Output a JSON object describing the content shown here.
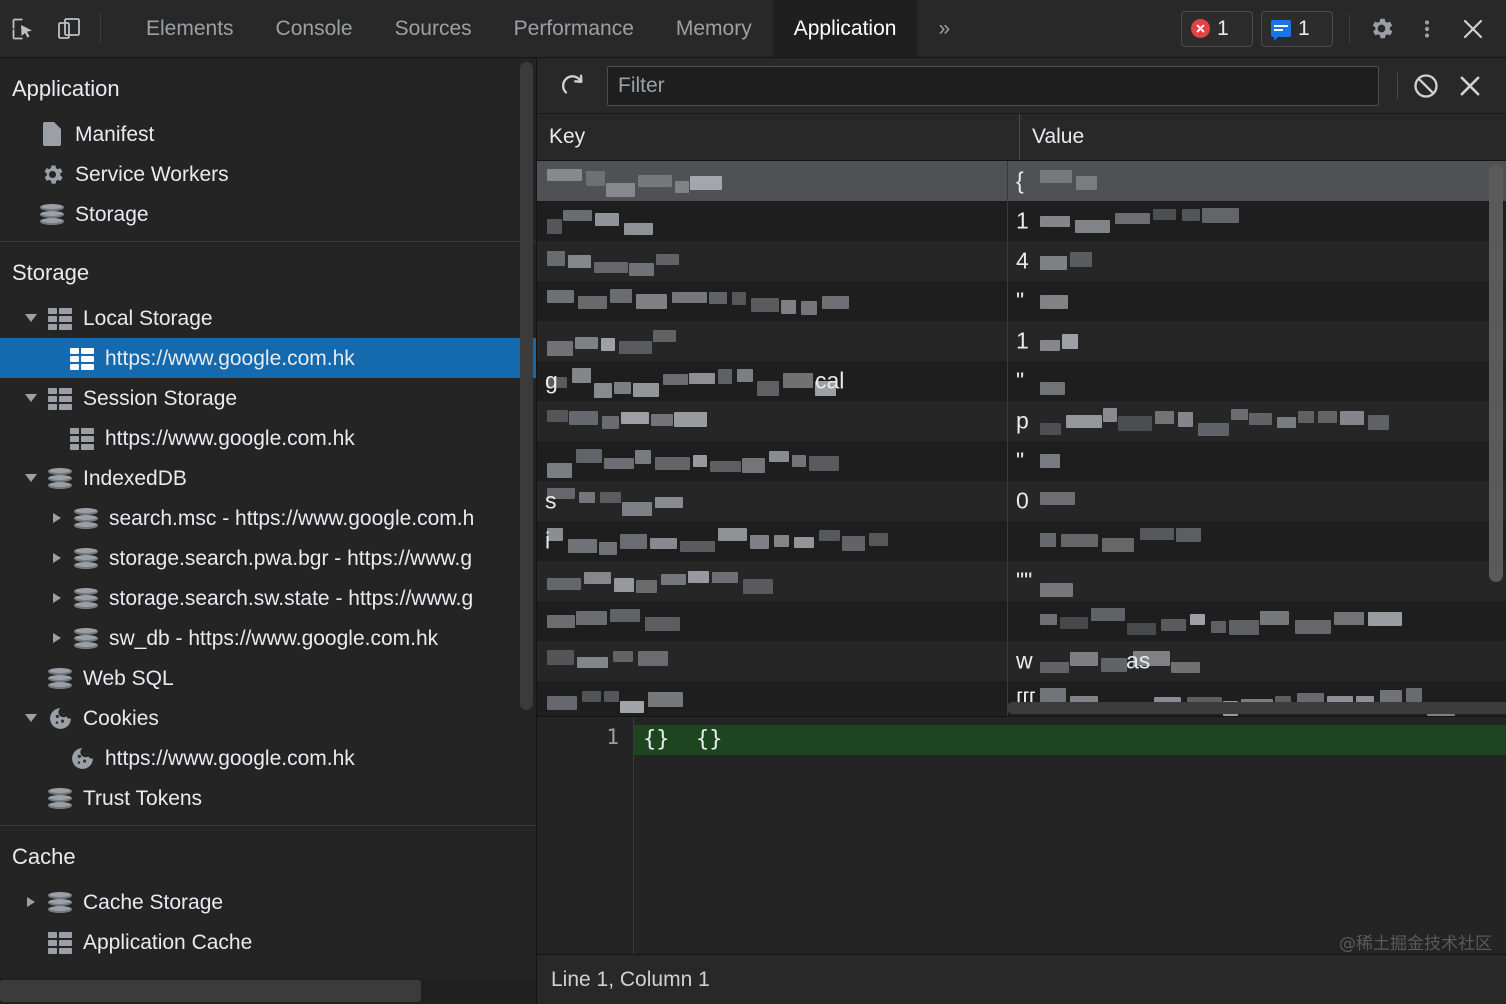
{
  "toolbar": {
    "inspect_icon": "inspect-element-icon",
    "device_icon": "toggle-device-toolbar-icon",
    "tabs": [
      {
        "label": "Elements",
        "active": false
      },
      {
        "label": "Console",
        "active": false
      },
      {
        "label": "Sources",
        "active": false
      },
      {
        "label": "Performance",
        "active": false
      },
      {
        "label": "Memory",
        "active": false
      },
      {
        "label": "Application",
        "active": true
      }
    ],
    "more_tabs_label": "»",
    "error_count": "1",
    "message_count": "1",
    "settings_icon": "gear-icon",
    "more_options_icon": "kebab-menu-icon",
    "close_icon": "close-icon"
  },
  "sidebar": {
    "sections": [
      {
        "title": "Application",
        "items": [
          {
            "label": "Manifest",
            "icon": "document-icon",
            "indent": 1,
            "twisty": "none",
            "selected": false
          },
          {
            "label": "Service Workers",
            "icon": "gear-icon",
            "indent": 1,
            "twisty": "none",
            "selected": false
          },
          {
            "label": "Storage",
            "icon": "database-icon",
            "indent": 1,
            "twisty": "none",
            "selected": false
          }
        ]
      },
      {
        "title": "Storage",
        "items": [
          {
            "label": "Local Storage",
            "icon": "table-icon",
            "indent": 1,
            "twisty": "open",
            "selected": false
          },
          {
            "label": "https://www.google.com.hk",
            "icon": "table-icon-white",
            "indent": 2,
            "twisty": "none",
            "selected": true
          },
          {
            "label": "Session Storage",
            "icon": "table-icon",
            "indent": 1,
            "twisty": "open",
            "selected": false
          },
          {
            "label": "https://www.google.com.hk",
            "icon": "table-icon",
            "indent": 2,
            "twisty": "none",
            "selected": false
          },
          {
            "label": "IndexedDB",
            "icon": "database-icon",
            "indent": 1,
            "twisty": "open",
            "selected": false
          },
          {
            "label": "search.msc - https://www.google.com.h",
            "icon": "database-icon",
            "indent": 2,
            "twisty": "closed",
            "selected": false
          },
          {
            "label": "storage.search.pwa.bgr - https://www.g",
            "icon": "database-icon",
            "indent": 2,
            "twisty": "closed",
            "selected": false
          },
          {
            "label": "storage.search.sw.state - https://www.g",
            "icon": "database-icon",
            "indent": 2,
            "twisty": "closed",
            "selected": false
          },
          {
            "label": "sw_db - https://www.google.com.hk",
            "icon": "database-icon",
            "indent": 2,
            "twisty": "closed",
            "selected": false
          },
          {
            "label": "Web SQL",
            "icon": "database-icon",
            "indent": 1,
            "twisty": "none",
            "selected": false
          },
          {
            "label": "Cookies",
            "icon": "cookie-icon",
            "indent": 1,
            "twisty": "open",
            "selected": false
          },
          {
            "label": "https://www.google.com.hk",
            "icon": "cookie-icon",
            "indent": 2,
            "twisty": "none",
            "selected": false
          },
          {
            "label": "Trust Tokens",
            "icon": "database-icon",
            "indent": 1,
            "twisty": "none",
            "selected": false
          }
        ]
      },
      {
        "title": "Cache",
        "items": [
          {
            "label": "Cache Storage",
            "icon": "database-icon",
            "indent": 1,
            "twisty": "closed",
            "selected": false
          },
          {
            "label": "Application Cache",
            "icon": "table-icon",
            "indent": 1,
            "twisty": "none",
            "selected": false
          }
        ]
      }
    ]
  },
  "storage_panel": {
    "refresh_icon": "refresh-icon",
    "filter": {
      "value": "",
      "placeholder": "Filter"
    },
    "clear_icon": "clear-all-icon",
    "delete_icon": "delete-selected-icon",
    "columns": [
      "Key",
      "Value"
    ],
    "rows": [
      {
        "key_lead": "",
        "value_lead": "{",
        "selected": true
      },
      {
        "key_lead": "",
        "value_lead": "1",
        "selected": false
      },
      {
        "key_lead": "",
        "value_lead": "4",
        "selected": false
      },
      {
        "key_lead": "",
        "value_lead": "\"",
        "selected": false
      },
      {
        "key_lead": "",
        "value_lead": "1",
        "selected": false
      },
      {
        "key_lead": "g",
        "value_lead": "\"",
        "selected": false
      },
      {
        "key_lead": "",
        "value_lead": "p",
        "selected": false
      },
      {
        "key_lead": "",
        "value_lead": "\"",
        "selected": false
      },
      {
        "key_lead": "s",
        "value_lead": "0",
        "selected": false
      },
      {
        "key_lead": "i",
        "value_lead": "",
        "selected": false
      },
      {
        "key_lead": "",
        "value_lead": "\"\"",
        "selected": false
      },
      {
        "key_lead": "",
        "value_lead": "",
        "selected": false
      },
      {
        "key_lead": "",
        "value_lead": "w",
        "selected": false
      },
      {
        "key_lead": "",
        "value_lead": "[[[",
        "selected": false
      }
    ],
    "partial_value_text_1": "cal",
    "partial_value_text_2": "as"
  },
  "editor": {
    "line_number": "1",
    "line_content": "{}  {}"
  },
  "statusbar": {
    "position": "Line 1, Column 1",
    "watermark": "@稀土掘金技术社区"
  },
  "colors": {
    "selection_blue": "#1569ad",
    "error_red": "#e34343",
    "message_blue": "#1a73e8",
    "code_green": "#1d4620",
    "panel_bg": "#242424",
    "toolbar_bg": "#282828"
  }
}
